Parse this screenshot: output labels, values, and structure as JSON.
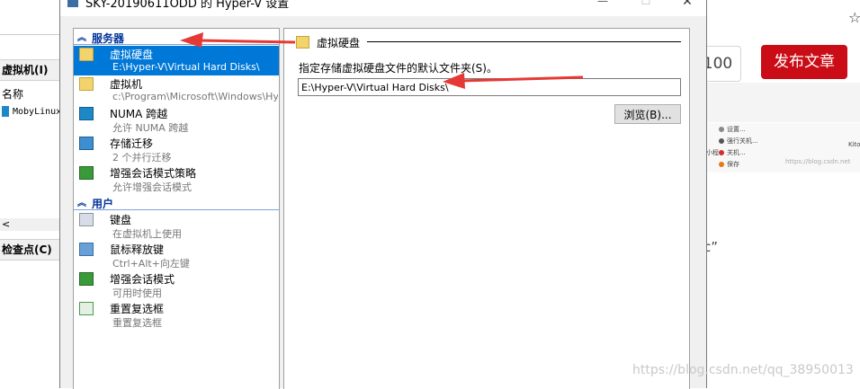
{
  "dialog": {
    "title": "SKY-20190611ODD 的 Hyper-V 设置",
    "controls": {
      "minimize": "—",
      "maximize": "☐",
      "close": "✕"
    }
  },
  "nav": {
    "sections": [
      {
        "label": "服务器",
        "items": [
          {
            "name": "虚拟硬盘",
            "sub": "E:\\Hyper-V\\Virtual Hard Disks\\",
            "icon": "virtual-hard-disk-icon",
            "selected": true
          },
          {
            "name": "虚拟机",
            "sub": "c:\\Program\\Microsoft\\Windows\\Hy...",
            "icon": "virtual-machine-icon"
          },
          {
            "name": "NUMA 跨越",
            "sub": "允许 NUMA 跨越",
            "icon": "numa-icon"
          },
          {
            "name": "存储迁移",
            "sub": "2 个并行迁移",
            "icon": "storage-migration-icon"
          },
          {
            "name": "增强会话模式策略",
            "sub": "允许增强会话模式",
            "icon": "enhanced-session-policy-icon"
          }
        ]
      },
      {
        "label": "用户",
        "items": [
          {
            "name": "键盘",
            "sub": "在虚拟机上使用",
            "icon": "keyboard-icon"
          },
          {
            "name": "鼠标释放键",
            "sub": "Ctrl+Alt+向左键",
            "icon": "mouse-release-icon"
          },
          {
            "name": "增强会话模式",
            "sub": "可用时使用",
            "icon": "enhanced-session-icon"
          },
          {
            "name": "重置复选框",
            "sub": "重置复选框",
            "icon": "reset-checkbox-icon"
          }
        ]
      }
    ]
  },
  "content": {
    "title": "虚拟硬盘",
    "label": "指定存储虚拟硬盘文件的默认文件夹(S)。",
    "path_value": "E:\\Hyper-V\\Virtual Hard Disks\\",
    "browse_label": "浏览(B)..."
  },
  "background_left": {
    "header1": "虚拟机(I)",
    "column": "名称",
    "vm_name": "MobyLinux",
    "scroll_left": "<",
    "header2": "检查点(C)"
  },
  "background_right": {
    "count": "100",
    "publish": "发布文章",
    "star": "☆",
    "thumb_items": [
      "设置...",
      "强行关机...",
      "关机...",
      "保存"
    ],
    "thumb_side_1": "Kito",
    "thumb_side_2": "小程",
    "thumb_link": "https://blog.csdn.net",
    "quote": "c”",
    "watermark": "https://blog.csdn.net/qq_38950013"
  },
  "colors": {
    "selection": "#0078d7",
    "section_header": "#003399",
    "publish_button": "#ca0c16",
    "annotation_arrow": "#e53935"
  }
}
